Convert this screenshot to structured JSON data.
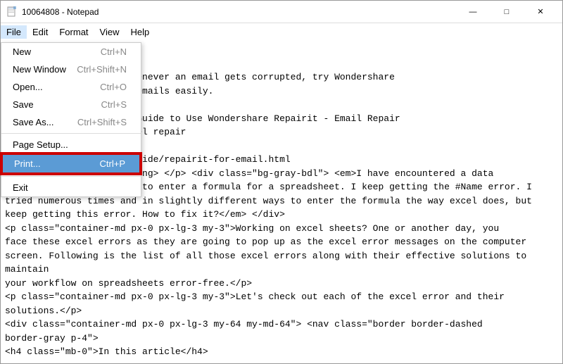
{
  "window": {
    "title": "10064808 - Notepad",
    "controls": {
      "minimize": "—",
      "maximize": "□",
      "close": "✕"
    }
  },
  "menubar": {
    "items": [
      {
        "id": "file",
        "label": "File",
        "active": true
      },
      {
        "id": "edit",
        "label": "Edit"
      },
      {
        "id": "format",
        "label": "Format"
      },
      {
        "id": "view",
        "label": "View"
      },
      {
        "id": "help",
        "label": "Help"
      }
    ]
  },
  "file_menu": {
    "items": [
      {
        "id": "new",
        "label": "New",
        "shortcut": "Ctrl+N",
        "highlighted": false,
        "separator_after": false
      },
      {
        "id": "new-window",
        "label": "New Window",
        "shortcut": "Ctrl+Shift+N",
        "highlighted": false,
        "separator_after": false
      },
      {
        "id": "open",
        "label": "Open...",
        "shortcut": "Ctrl+O",
        "highlighted": false,
        "separator_after": false
      },
      {
        "id": "save",
        "label": "Save",
        "shortcut": "Ctrl+S",
        "highlighted": false,
        "separator_after": false
      },
      {
        "id": "save-as",
        "label": "Save As...",
        "shortcut": "Ctrl+Shift+S",
        "highlighted": false,
        "separator_after": true
      },
      {
        "id": "page-setup",
        "label": "Page Setup...",
        "shortcut": "",
        "highlighted": false,
        "separator_after": false
      },
      {
        "id": "print",
        "label": "Print...",
        "shortcut": "Ctrl+P",
        "highlighted": true,
        "separator_after": true
      },
      {
        "id": "exit",
        "label": "Exit",
        "shortcut": "",
        "highlighted": false,
        "separator_after": false
      }
    ]
  },
  "content": {
    "lines": "</p>\n<strong> </p>email repair\n<strong></strong> </p>Whenever an email gets corrupted, try Wondershare\nts you repair corrupted emails easily.\n> </p>10064808\n<strong></strong> </p>A Guide to Use Wondershare Repairit - Email Repair\n<strong></strong></p>Excel repair\n<> </p>10005682\n<strong></strong> </p>/guide/repairit-for-email.html\n<p><strong>content:</strong> </p> <div class=\"bg-gray-bdl\"> <em>I have encountered a data\nentry problem when I try to enter a formula for a spreadsheet. I keep getting the #Name error. I\ntried numerous times and in slightly different ways to enter the formula the way excel does, but\nkeep getting this error. How to fix it?</em> </div>\n<p class=\"container-md px-0 px-lg-3 my-3\">Working on excel sheets? One or another day, you\nface these excel errors as they are going to pop up as the excel error messages on the computer\nscreen. Following is the list of all those excel errors along with their effective solutions to maintain\nyour workflow on spreadsheets error-free.</p>\n<p class=\"container-md px-0 px-lg-3 my-3\">Let's check out each of the excel error and their\nsolutions.</p>\n<div class=\"container-md px-0 px-lg-3 my-64 my-md-64\"> <nav class=\"border border-dashed\nborder-gray p-4\">\n<h4 class=\"mb-0\">In this article</h4>"
  }
}
